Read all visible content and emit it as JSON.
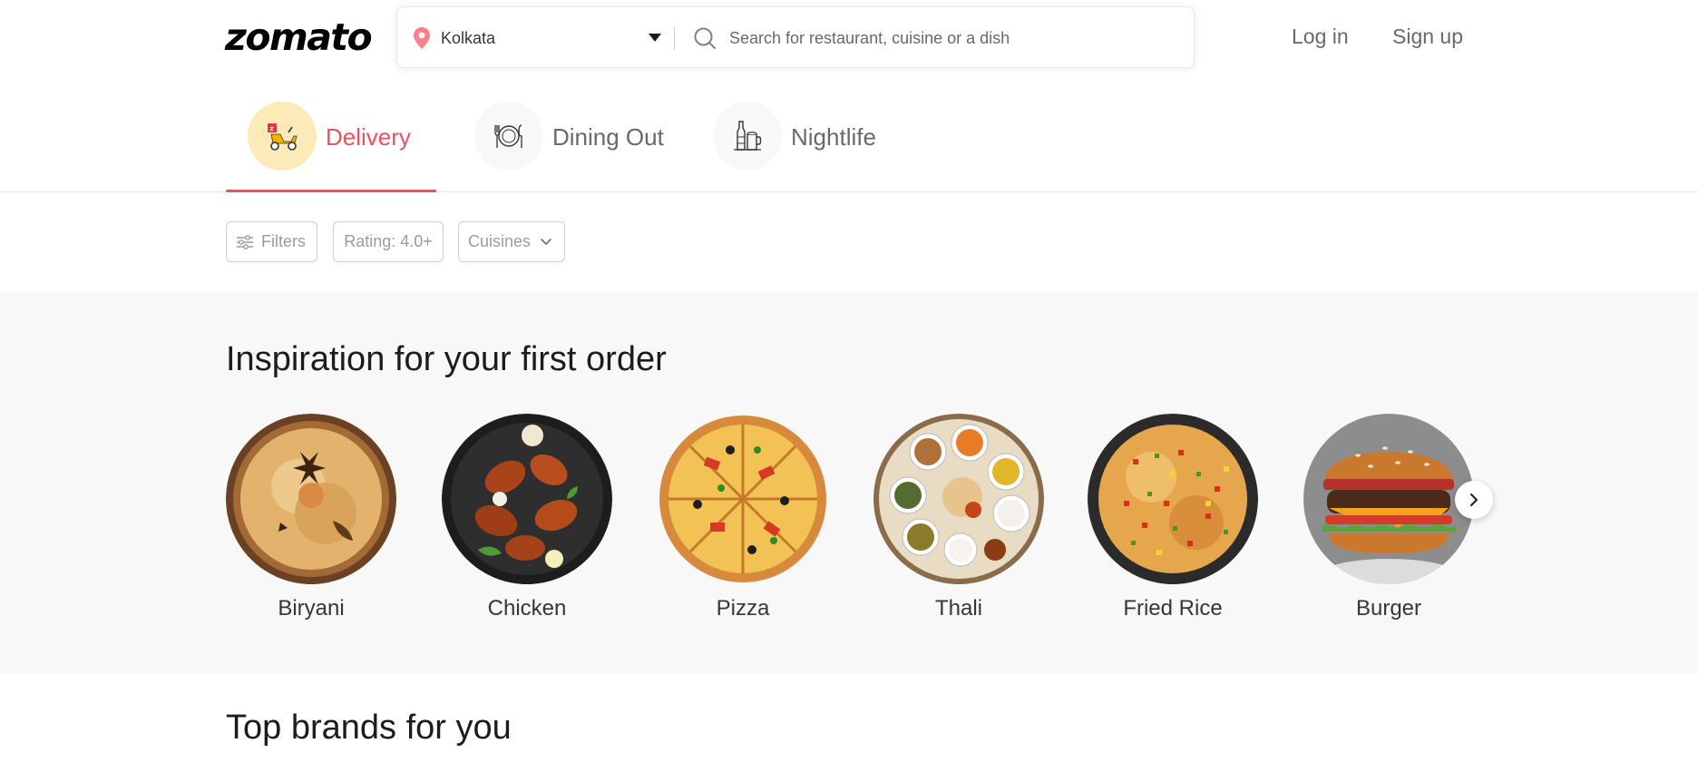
{
  "header": {
    "logo": "zomato",
    "location": "Kolkata",
    "search_placeholder": "Search for restaurant, cuisine or a dish",
    "login": "Log in",
    "signup": "Sign up"
  },
  "tabs": [
    {
      "label": "Delivery",
      "active": true,
      "icon": "delivery-scooter-icon"
    },
    {
      "label": "Dining Out",
      "active": false,
      "icon": "dining-plate-icon"
    },
    {
      "label": "Nightlife",
      "active": false,
      "icon": "nightlife-drinks-icon"
    }
  ],
  "filters": {
    "filters_label": "Filters",
    "rating_label": "Rating: 4.0+",
    "cuisines_label": "Cuisines"
  },
  "inspiration": {
    "title": "Inspiration for your first order",
    "items": [
      {
        "label": "Biryani"
      },
      {
        "label": "Chicken"
      },
      {
        "label": "Pizza"
      },
      {
        "label": "Thali"
      },
      {
        "label": "Fried Rice"
      },
      {
        "label": "Burger"
      }
    ]
  },
  "brands": {
    "title": "Top brands for you"
  },
  "colors": {
    "accent": "#ef4f5f",
    "active_tab_bg": "#fcebb8",
    "section_bg": "#f8f8f8"
  }
}
